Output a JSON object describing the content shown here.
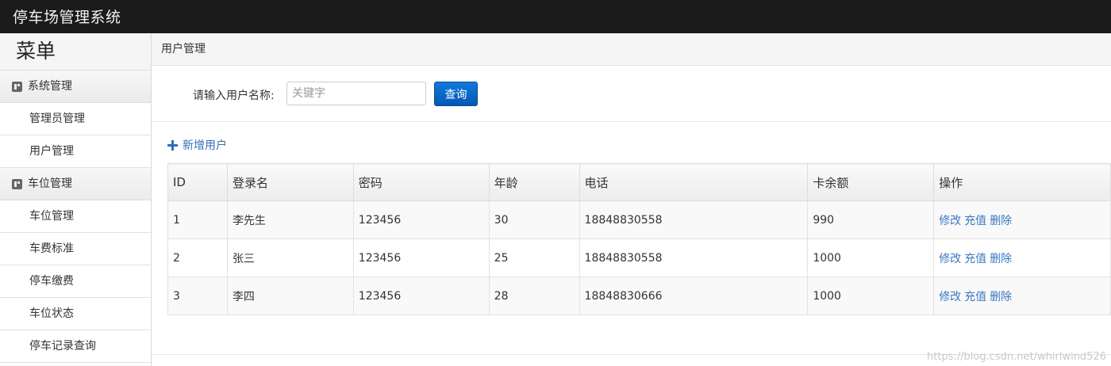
{
  "app": {
    "title": "停车场管理系统"
  },
  "sidebar": {
    "title": "菜单",
    "groups": [
      {
        "label": "系统管理",
        "icon": "category-icon",
        "items": [
          "管理员管理",
          "用户管理"
        ]
      },
      {
        "label": "车位管理",
        "icon": "category-icon",
        "items": [
          "车位管理",
          "车费标准",
          "停车缴费",
          "车位状态",
          "停车记录查询"
        ]
      }
    ]
  },
  "breadcrumb": "用户管理",
  "search": {
    "label": "请输入用户名称:",
    "placeholder": "关键字",
    "button": "查询"
  },
  "add_user": {
    "label": "新增用户",
    "icon": "plus-icon"
  },
  "table": {
    "headers": [
      "ID",
      "登录名",
      "密码",
      "年龄",
      "电话",
      "卡余额",
      "操作"
    ],
    "actions": [
      "修改",
      "充值",
      "删除"
    ],
    "rows": [
      [
        "1",
        "李先生",
        "123456",
        "30",
        "18848830558",
        "990"
      ],
      [
        "2",
        "张三",
        "123456",
        "25",
        "18848830558",
        "1000"
      ],
      [
        "3",
        "李四",
        "123456",
        "28",
        "18848830666",
        "1000"
      ]
    ]
  },
  "watermark": "https://blog.csdn.net/whirlwind526",
  "colors": {
    "topbar": "#1b1b1b",
    "primary": "#0b6fcf",
    "link": "#3a78c2"
  }
}
